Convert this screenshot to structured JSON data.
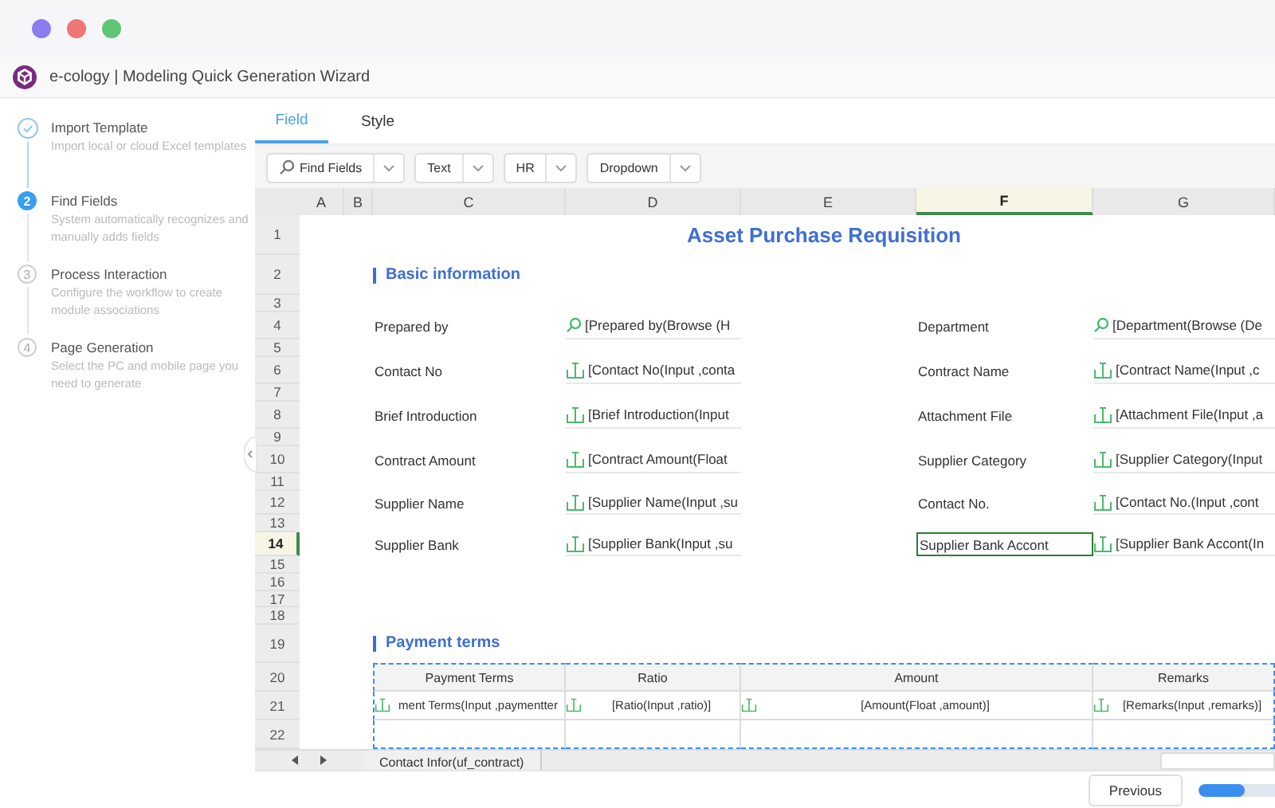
{
  "window": {
    "title": "e-cology | Modeling Quick Generation Wizard"
  },
  "steps": [
    {
      "title": "Import Template",
      "description": "Import local or cloud Excel templates",
      "kind": "done"
    },
    {
      "number": "2",
      "title": "Find Fields",
      "description": "System automatically recognizes and manually adds fields",
      "kind": "current"
    },
    {
      "number": "3",
      "title": "Process Interaction",
      "description": "Configure the workflow to create module associations",
      "kind": "todo"
    },
    {
      "number": "4",
      "title": "Page Generation",
      "description": "Select the PC and mobile page you need to generate",
      "kind": "todo"
    }
  ],
  "tabs": [
    {
      "label": "Field",
      "selected": true
    },
    {
      "label": "Style",
      "selected": false
    }
  ],
  "toolbar": [
    {
      "label": "Find Fields",
      "kind": "search"
    },
    {
      "label": "Text",
      "kind": "plain"
    },
    {
      "label": "HR",
      "kind": "plain"
    },
    {
      "label": "Dropdown",
      "kind": "plain"
    }
  ],
  "sheet": {
    "columns": [
      {
        "label": "A",
        "selected": false
      },
      {
        "label": "B",
        "selected": false
      },
      {
        "label": "C",
        "selected": false
      },
      {
        "label": "D",
        "selected": false
      },
      {
        "label": "E",
        "selected": false
      },
      {
        "label": "F",
        "selected": true
      },
      {
        "label": "G",
        "selected": false
      }
    ],
    "rows": [
      {
        "label": "1",
        "selected": false
      },
      {
        "label": "2",
        "selected": false
      },
      {
        "label": "3",
        "selected": false
      },
      {
        "label": "4",
        "selected": false
      },
      {
        "label": "5",
        "selected": false
      },
      {
        "label": "6",
        "selected": false
      },
      {
        "label": "7",
        "selected": false
      },
      {
        "label": "8",
        "selected": false
      },
      {
        "label": "9",
        "selected": false
      },
      {
        "label": "10",
        "selected": false
      },
      {
        "label": "11",
        "selected": false
      },
      {
        "label": "12",
        "selected": false
      },
      {
        "label": "13",
        "selected": false
      },
      {
        "label": "14",
        "selected": true
      },
      {
        "label": "15",
        "selected": false
      },
      {
        "label": "16",
        "selected": false
      },
      {
        "label": "17",
        "selected": false
      },
      {
        "label": "18",
        "selected": false
      },
      {
        "label": "19",
        "selected": false
      },
      {
        "label": "20",
        "selected": false
      },
      {
        "label": "21",
        "selected": false
      },
      {
        "label": "22",
        "selected": false
      }
    ],
    "title": "Asset Purchase Requisition",
    "basic": {
      "heading": "Basic information",
      "fields": [
        {
          "label": "Prepared by",
          "kind": "browse",
          "value": "[Prepared by(Browse (H",
          "selected": false
        },
        {
          "label": "Department",
          "kind": "browse",
          "value": "[Department(Browse (De",
          "selected": false
        },
        {
          "label": "Contact No",
          "kind": "input",
          "value": "[Contact No(Input ,conta",
          "selected": false
        },
        {
          "label": "Contract Name",
          "kind": "input",
          "value": "[Contract Name(Input ,c",
          "selected": false
        },
        {
          "label": "Brief Introduction",
          "kind": "input",
          "value": "[Brief Introduction(Input",
          "selected": false
        },
        {
          "label": "Attachment File",
          "kind": "input",
          "value": "[Attachment File(Input ,a",
          "selected": false
        },
        {
          "label": "Contract Amount",
          "kind": "input",
          "value": "[Contract Amount(Float",
          "selected": false
        },
        {
          "label": "Supplier Category",
          "kind": "input",
          "value": "[Supplier Category(Input",
          "selected": false
        },
        {
          "label": "Supplier Name",
          "kind": "input",
          "value": "[Supplier Name(Input ,su",
          "selected": false
        },
        {
          "label": "Contact No.",
          "kind": "input",
          "value": "[Contact No.(Input ,cont",
          "selected": false
        },
        {
          "label": "Supplier Bank",
          "kind": "input",
          "value": "[Supplier Bank(Input ,su",
          "selected": false
        },
        {
          "label": "Supplier Bank Accont",
          "kind": "input",
          "value": "[Supplier Bank Accont(In",
          "selected": true
        }
      ]
    },
    "payment": {
      "heading": "Payment terms",
      "columns": [
        "Payment Terms",
        "Ratio",
        "Amount",
        "Remarks"
      ],
      "cells": [
        {
          "kind": "input",
          "value": "ment Terms(Input ,paymentter"
        },
        {
          "kind": "input",
          "value": "[Ratio(Input ,ratio)]"
        },
        {
          "kind": "input",
          "value": "[Amount(Float ,amount)]"
        },
        {
          "kind": "input",
          "value": "[Remarks(Input ,remarks)]"
        }
      ]
    }
  },
  "sheet_tabs": [
    {
      "label": "Contact Infor(uf_contract)",
      "selected": true
    }
  ],
  "footer": {
    "previous": "Previous",
    "progress": {
      "level": 0.6
    }
  }
}
